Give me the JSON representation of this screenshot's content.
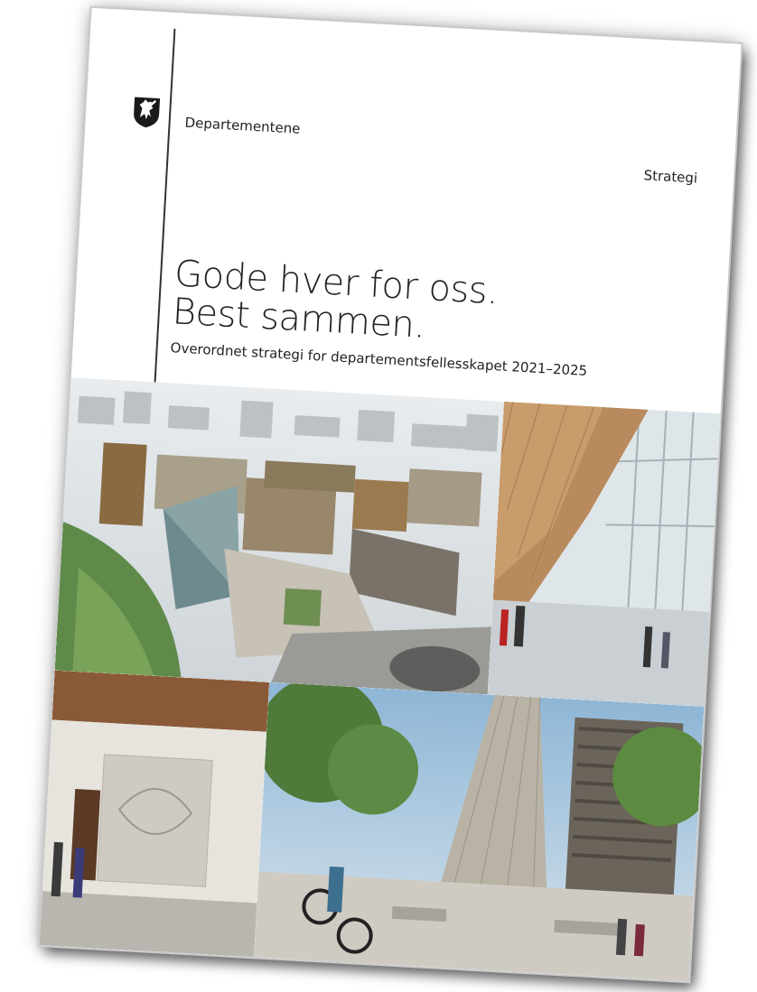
{
  "header": {
    "department": "Departementene",
    "document_type": "Strategi"
  },
  "cover": {
    "title_line1": "Gode hver for oss.",
    "title_line2": "Best sammen.",
    "subtitle": "Overordnet strategi for departementsfellesskapet 2021–2025"
  },
  "icons": {
    "crest": "coat-of-arms-lion-icon"
  },
  "colors": {
    "text": "#222222",
    "page": "#ffffff"
  }
}
